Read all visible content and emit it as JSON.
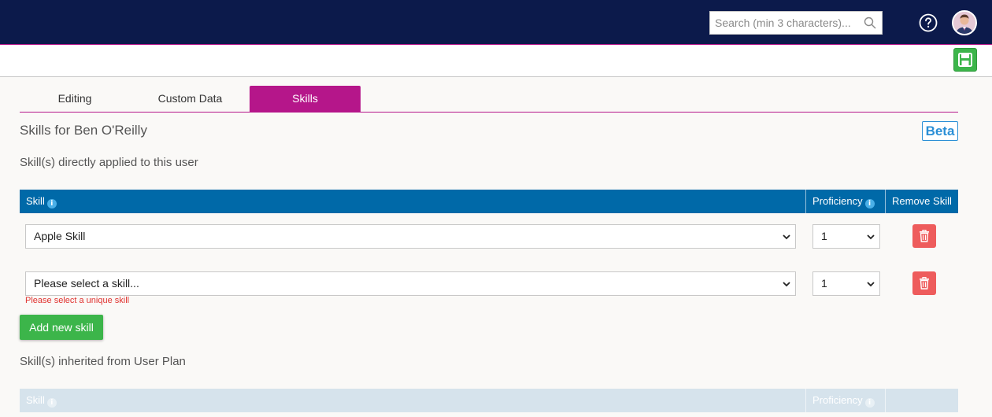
{
  "header": {
    "search_placeholder": "Search (min 3 characters)..."
  },
  "tabs": [
    {
      "label": "Editing"
    },
    {
      "label": "Custom Data"
    },
    {
      "label": "Skills",
      "active": true
    }
  ],
  "page": {
    "title": "Skills for Ben O'Reilly",
    "badge": "Beta",
    "direct_section": "Skill(s) directly applied to this user",
    "inherited_section": "Skill(s) inherited from User Plan"
  },
  "table": {
    "col_skill": "Skill",
    "col_proficiency": "Proficiency",
    "col_remove": "Remove Skill",
    "rows": [
      {
        "skill": "Apple Skill",
        "proficiency": "1"
      },
      {
        "skill": "Please select a skill...",
        "proficiency": "1",
        "error": "Please select a unique skill"
      }
    ]
  },
  "add_button": "Add new skill",
  "inherited_table": {
    "col_skill": "Skill",
    "col_proficiency": "Proficiency"
  },
  "colors": {
    "topbar": "#0c1a4b",
    "accent": "#b5168a",
    "table_header": "#0069a8",
    "inherited_header": "#d6e3ec",
    "add_button": "#3cb54a",
    "remove_button": "#ee5c5c",
    "error": "#e0322f"
  }
}
